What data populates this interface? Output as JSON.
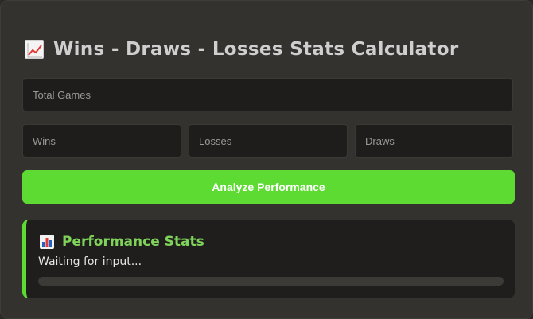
{
  "header": {
    "title": "Wins - Draws - Losses Stats Calculator",
    "icon": "chart-increasing-icon"
  },
  "inputs": {
    "total_games": {
      "placeholder": "Total Games",
      "value": ""
    },
    "wins": {
      "placeholder": "Wins",
      "value": ""
    },
    "losses": {
      "placeholder": "Losses",
      "value": ""
    },
    "draws": {
      "placeholder": "Draws",
      "value": ""
    }
  },
  "analyze_button": {
    "label": "Analyze Performance"
  },
  "stats_panel": {
    "title": "Performance Stats",
    "icon": "bar-chart-icon",
    "status": "Waiting for input...",
    "progress_fraction": 0
  },
  "colors": {
    "accent": "#5ddb33",
    "stats_title": "#7fd25a"
  }
}
